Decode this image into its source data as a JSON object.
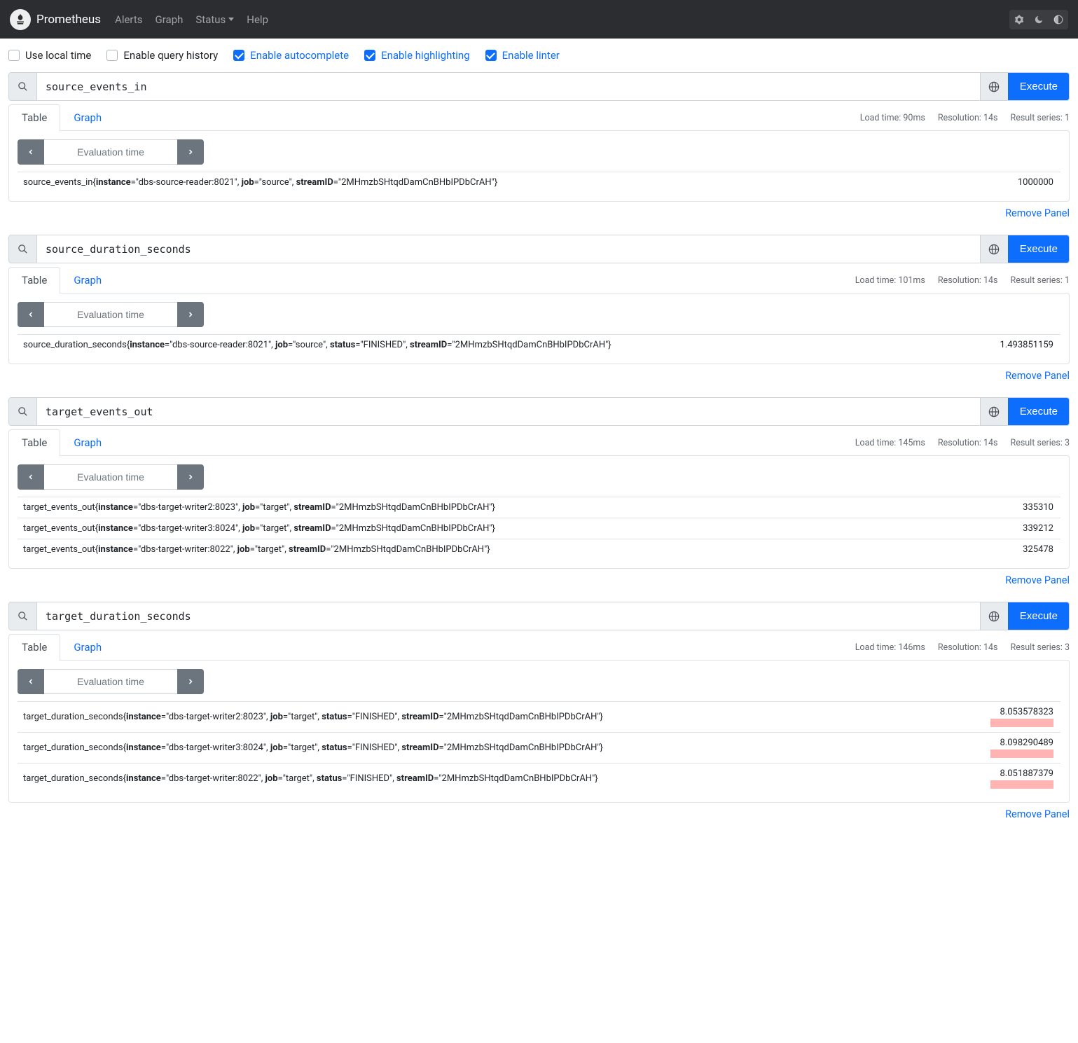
{
  "brand": "Prometheus",
  "nav": {
    "alerts": "Alerts",
    "graph": "Graph",
    "status": "Status",
    "help": "Help"
  },
  "toggles": {
    "local_time": {
      "label": "Use local time",
      "checked": false
    },
    "query_history": {
      "label": "Enable query history",
      "checked": false
    },
    "autocomplete": {
      "label": "Enable autocomplete",
      "checked": true
    },
    "highlighting": {
      "label": "Enable highlighting",
      "checked": true
    },
    "linter": {
      "label": "Enable linter",
      "checked": true
    }
  },
  "labels": {
    "execute": "Execute",
    "table": "Table",
    "graph": "Graph",
    "eval_placeholder": "Evaluation time",
    "remove": "Remove Panel",
    "load_prefix": "Load time: ",
    "res_prefix": "Resolution: ",
    "series_prefix": "Result series: "
  },
  "panels": [
    {
      "query": "source_events_in",
      "load": "90ms",
      "resolution": "14s",
      "series": "1",
      "highlight": false,
      "rows": [
        {
          "name": "source_events_in",
          "labels": [
            {
              "k": "instance",
              "v": "dbs-source-reader:8021"
            },
            {
              "k": "job",
              "v": "source"
            },
            {
              "k": "streamID",
              "v": "2MHmzbSHtqdDamCnBHbIPDbCrAH"
            }
          ],
          "value": "1000000"
        }
      ]
    },
    {
      "query": "source_duration_seconds",
      "load": "101ms",
      "resolution": "14s",
      "series": "1",
      "highlight": false,
      "rows": [
        {
          "name": "source_duration_seconds",
          "labels": [
            {
              "k": "instance",
              "v": "dbs-source-reader:8021"
            },
            {
              "k": "job",
              "v": "source"
            },
            {
              "k": "status",
              "v": "FINISHED"
            },
            {
              "k": "streamID",
              "v": "2MHmzbSHtqdDamCnBHbIPDbCrAH"
            }
          ],
          "value": "1.493851159"
        }
      ]
    },
    {
      "query": "target_events_out",
      "load": "145ms",
      "resolution": "14s",
      "series": "3",
      "highlight": false,
      "rows": [
        {
          "name": "target_events_out",
          "labels": [
            {
              "k": "instance",
              "v": "dbs-target-writer2:8023"
            },
            {
              "k": "job",
              "v": "target"
            },
            {
              "k": "streamID",
              "v": "2MHmzbSHtqdDamCnBHbIPDbCrAH"
            }
          ],
          "value": "335310"
        },
        {
          "name": "target_events_out",
          "labels": [
            {
              "k": "instance",
              "v": "dbs-target-writer3:8024"
            },
            {
              "k": "job",
              "v": "target"
            },
            {
              "k": "streamID",
              "v": "2MHmzbSHtqdDamCnBHbIPDbCrAH"
            }
          ],
          "value": "339212"
        },
        {
          "name": "target_events_out",
          "labels": [
            {
              "k": "instance",
              "v": "dbs-target-writer:8022"
            },
            {
              "k": "job",
              "v": "target"
            },
            {
              "k": "streamID",
              "v": "2MHmzbSHtqdDamCnBHbIPDbCrAH"
            }
          ],
          "value": "325478"
        }
      ]
    },
    {
      "query": "target_duration_seconds",
      "load": "146ms",
      "resolution": "14s",
      "series": "3",
      "highlight": true,
      "rows": [
        {
          "name": "target_duration_seconds",
          "labels": [
            {
              "k": "instance",
              "v": "dbs-target-writer2:8023"
            },
            {
              "k": "job",
              "v": "target"
            },
            {
              "k": "status",
              "v": "FINISHED"
            },
            {
              "k": "streamID",
              "v": "2MHmzbSHtqdDamCnBHbIPDbCrAH"
            }
          ],
          "value": "8.053578323"
        },
        {
          "name": "target_duration_seconds",
          "labels": [
            {
              "k": "instance",
              "v": "dbs-target-writer3:8024"
            },
            {
              "k": "job",
              "v": "target"
            },
            {
              "k": "status",
              "v": "FINISHED"
            },
            {
              "k": "streamID",
              "v": "2MHmzbSHtqdDamCnBHbIPDbCrAH"
            }
          ],
          "value": "8.098290489"
        },
        {
          "name": "target_duration_seconds",
          "labels": [
            {
              "k": "instance",
              "v": "dbs-target-writer:8022"
            },
            {
              "k": "job",
              "v": "target"
            },
            {
              "k": "status",
              "v": "FINISHED"
            },
            {
              "k": "streamID",
              "v": "2MHmzbSHtqdDamCnBHbIPDbCrAH"
            }
          ],
          "value": "8.051887379"
        }
      ]
    }
  ]
}
